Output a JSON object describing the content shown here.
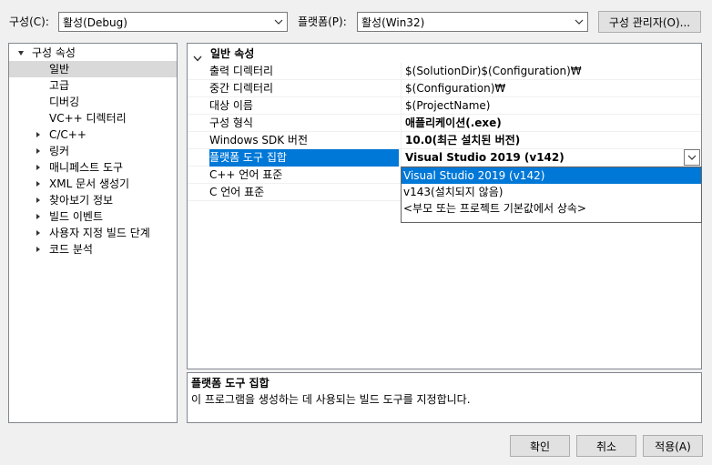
{
  "toolbar": {
    "config_label": "구성(C):",
    "config_value": "활성(Debug)",
    "platform_label": "플랫폼(P):",
    "platform_value": "활성(Win32)",
    "config_manager_button": "구성 관리자(O)..."
  },
  "tree": {
    "root_label": "구성 속성",
    "items": [
      {
        "label": "일반",
        "expandable": false,
        "selected": true
      },
      {
        "label": "고급",
        "expandable": false
      },
      {
        "label": "디버깅",
        "expandable": false
      },
      {
        "label": "VC++ 디렉터리",
        "expandable": false
      },
      {
        "label": "C/C++",
        "expandable": true
      },
      {
        "label": "링커",
        "expandable": true
      },
      {
        "label": "매니페스트 도구",
        "expandable": true
      },
      {
        "label": "XML 문서 생성기",
        "expandable": true
      },
      {
        "label": "찾아보기 정보",
        "expandable": true
      },
      {
        "label": "빌드 이벤트",
        "expandable": true
      },
      {
        "label": "사용자 지정 빌드 단계",
        "expandable": true
      },
      {
        "label": "코드 분석",
        "expandable": true
      }
    ]
  },
  "grid": {
    "category": "일반 속성",
    "rows": [
      {
        "name": "출력 디렉터리",
        "value": "$(SolutionDir)$(Configuration)₩",
        "bold": false
      },
      {
        "name": "중간 디렉터리",
        "value": "$(Configuration)₩",
        "bold": false
      },
      {
        "name": "대상 이름",
        "value": "$(ProjectName)",
        "bold": false
      },
      {
        "name": "구성 형식",
        "value": "애플리케이션(.exe)",
        "bold": true
      },
      {
        "name": "Windows SDK 버전",
        "value": "10.0(최근 설치된 버전)",
        "bold": true
      },
      {
        "name": "플랫폼 도구 집합",
        "value": "Visual Studio 2019 (v142)",
        "bold": true,
        "selected": true
      },
      {
        "name": "C++ 언어 표준",
        "value": "",
        "bold": false
      },
      {
        "name": "C 언어 표준",
        "value": "",
        "bold": false
      }
    ]
  },
  "dropdown": {
    "options": [
      "Visual Studio 2019 (v142)",
      "v143(설치되지 않음)",
      "<부모 또는 프로젝트 기본값에서 상속>"
    ],
    "highlighted_index": 0
  },
  "description": {
    "title": "플랫폼 도구 집합",
    "text": "이 프로그램을 생성하는 데 사용되는 빌드 도구를 지정합니다."
  },
  "buttons": {
    "ok": "확인",
    "cancel": "취소",
    "apply": "적용(A)"
  },
  "colors": {
    "selection": "#0078d7",
    "tree_selection": "#d9d9d9",
    "background": "#f0f0f0"
  }
}
